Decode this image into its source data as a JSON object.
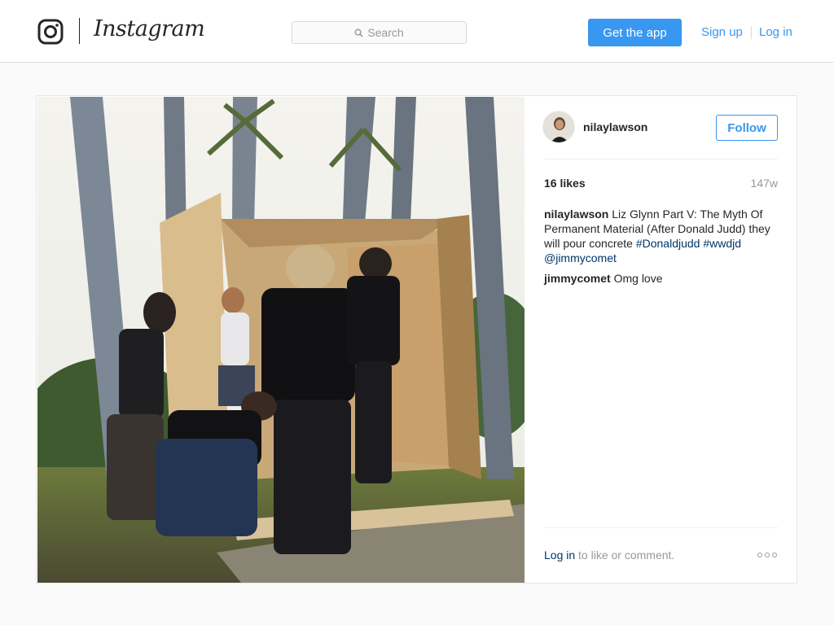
{
  "header": {
    "brand": "Instagram",
    "search_placeholder": "Search",
    "get_app_label": "Get the app",
    "signup_label": "Sign up",
    "login_label": "Log in"
  },
  "post": {
    "username": "nilaylawson",
    "follow_label": "Follow",
    "likes": "16 likes",
    "age": "147w",
    "caption": {
      "author": "nilaylawson",
      "text": "Liz Glynn Part V: The Myth Of Permanent Material (After Donald Judd) they will pour concrete",
      "hashtag1": "#Donaldjudd",
      "hashtag2": "#wwdjd",
      "mention": "@jimmycomet"
    },
    "comments": [
      {
        "author": "jimmycomet",
        "text": "Omg love"
      }
    ],
    "cta_link": "Log in",
    "cta_text": "to like or comment."
  },
  "icons": {
    "logo": "instagram-glyph-icon",
    "search": "search-icon",
    "options": "more-options-icon"
  },
  "colors": {
    "accent": "#3897f0",
    "link_dark": "#003569",
    "muted": "#999999",
    "border": "#dbdbdb"
  }
}
